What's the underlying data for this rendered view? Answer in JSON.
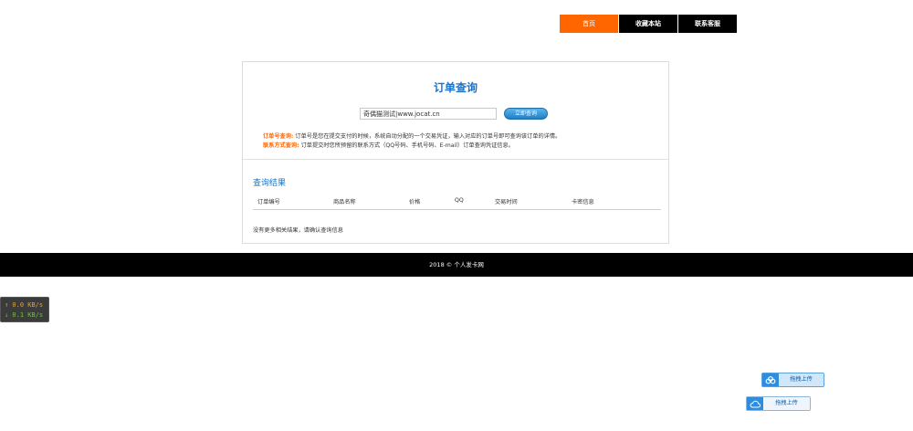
{
  "nav": {
    "items": [
      {
        "label": "首页",
        "active": true
      },
      {
        "label": "收藏本站",
        "active": false
      },
      {
        "label": "联系客服",
        "active": false
      }
    ],
    "active_color": "#ff6600"
  },
  "query": {
    "title": "订单查询",
    "input_value": "奇偶猫测试|www.jocat.cn",
    "button_label": "立即查询",
    "tips": [
      {
        "label": "订单号查询:",
        "text": "订单号是您在提交支付的时候，系统自动分配的一个交易凭证，输入对应的订单号即可查询该订单的详情。"
      },
      {
        "label": "联系方式查询:",
        "text": "订单提交时您所预留的联系方式（QQ号码、手机号码、E-mail）订单查询凭证信息。"
      }
    ]
  },
  "results": {
    "title": "查询结果",
    "columns": [
      "订单编号",
      "商品名称",
      "价格",
      "QQ",
      "交易时间",
      "卡密信息"
    ],
    "empty_message": "没有更多相关结果，请确认查询信息"
  },
  "footer": {
    "text": "2018 © 个人发卡网"
  },
  "speed": {
    "up": "↑ 0.0 KB/s",
    "down": "↓ 0.1 KB/s"
  },
  "upload": {
    "label_1": "拖拽上传",
    "label_2": "拖拽上传",
    "icon": "cloud-icon"
  },
  "colors": {
    "accent": "#1a73c6",
    "orange": "#ff6600"
  }
}
